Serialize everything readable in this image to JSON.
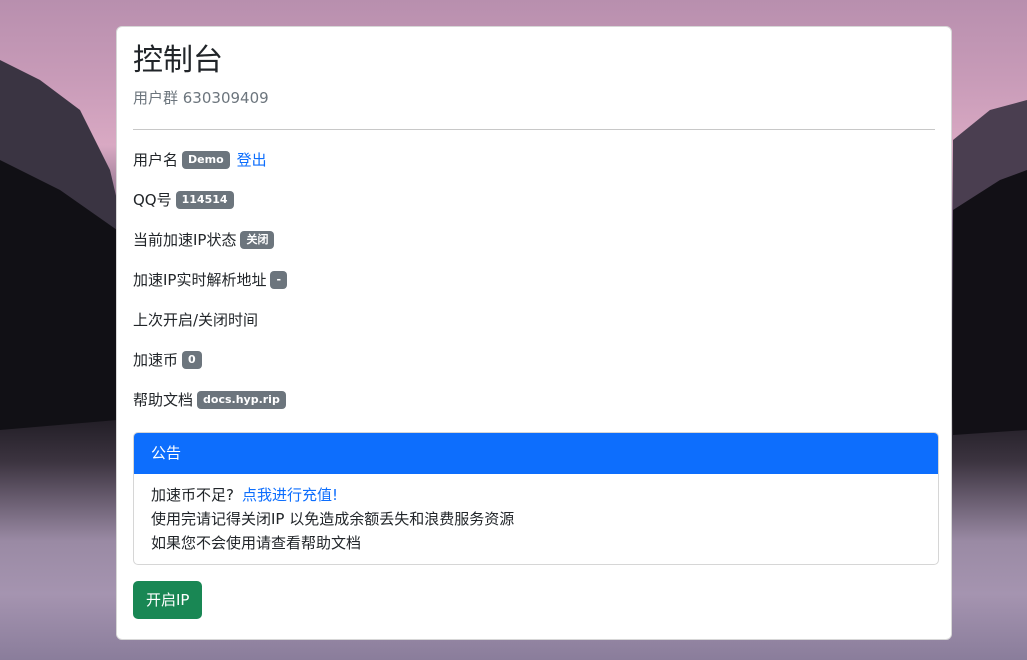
{
  "header": {
    "title": "控制台",
    "subtitle": "用户群 630309409"
  },
  "info": {
    "username_label": "用户名",
    "username_value": "Demo",
    "logout_label": "登出",
    "qq_label": "QQ号",
    "qq_value": "114514",
    "ip_status_label": "当前加速IP状态",
    "ip_status_value": "关闭",
    "resolve_label": "加速IP实时解析地址",
    "resolve_value": "-",
    "last_toggle_label": "上次开启/关闭时间",
    "coins_label": "加速币",
    "coins_value": "0",
    "docs_label": "帮助文档",
    "docs_value": "docs.hyp.rip"
  },
  "notice": {
    "header": "公告",
    "line1_text": "加速币不足?",
    "line1_link": "点我进行充值!",
    "line2": "使用完请记得关闭IP 以免造成余额丢失和浪费服务资源",
    "line3": "如果您不会使用请查看帮助文档"
  },
  "actions": {
    "start_label": "开启IP"
  },
  "colors": {
    "primary": "#0d6efd",
    "success": "#198754",
    "badge": "#6c757d"
  }
}
